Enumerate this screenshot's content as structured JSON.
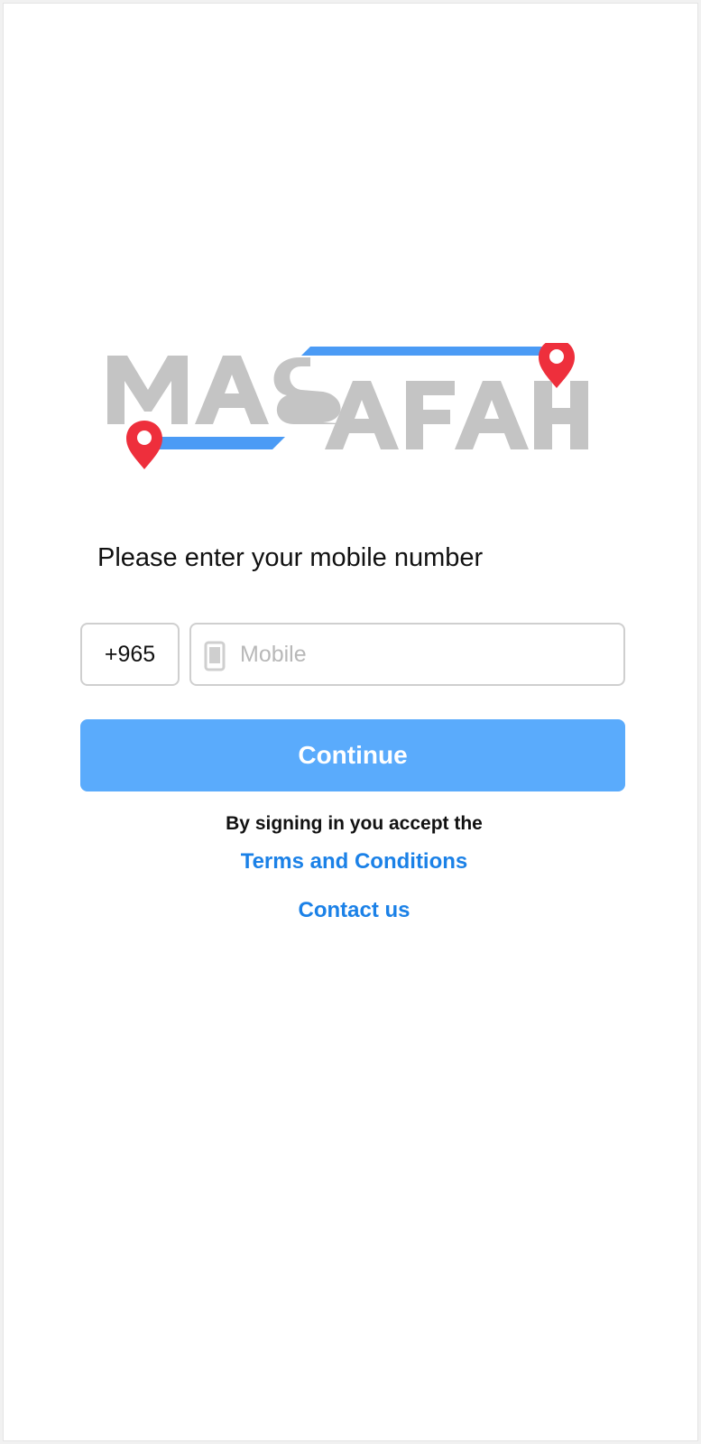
{
  "brand": {
    "name": "MASAFAH",
    "colors": {
      "grey": "#c4c4c4",
      "blue": "#4b9bf5",
      "pin_red": "#ee2f3c"
    }
  },
  "login": {
    "prompt": "Please enter your mobile number",
    "country_code": "+965",
    "mobile_icon": "smartphone-icon",
    "mobile_placeholder": "Mobile",
    "mobile_value": "",
    "continue_label": "Continue",
    "accept_text": "By signing in you accept the",
    "terms_link": "Terms and Conditions",
    "contact_link": "Contact us"
  },
  "colors": {
    "primary_button": "#5aabfc",
    "link": "#1b81e7",
    "input_border": "#cfcfcf",
    "placeholder": "#b8b8b8"
  }
}
